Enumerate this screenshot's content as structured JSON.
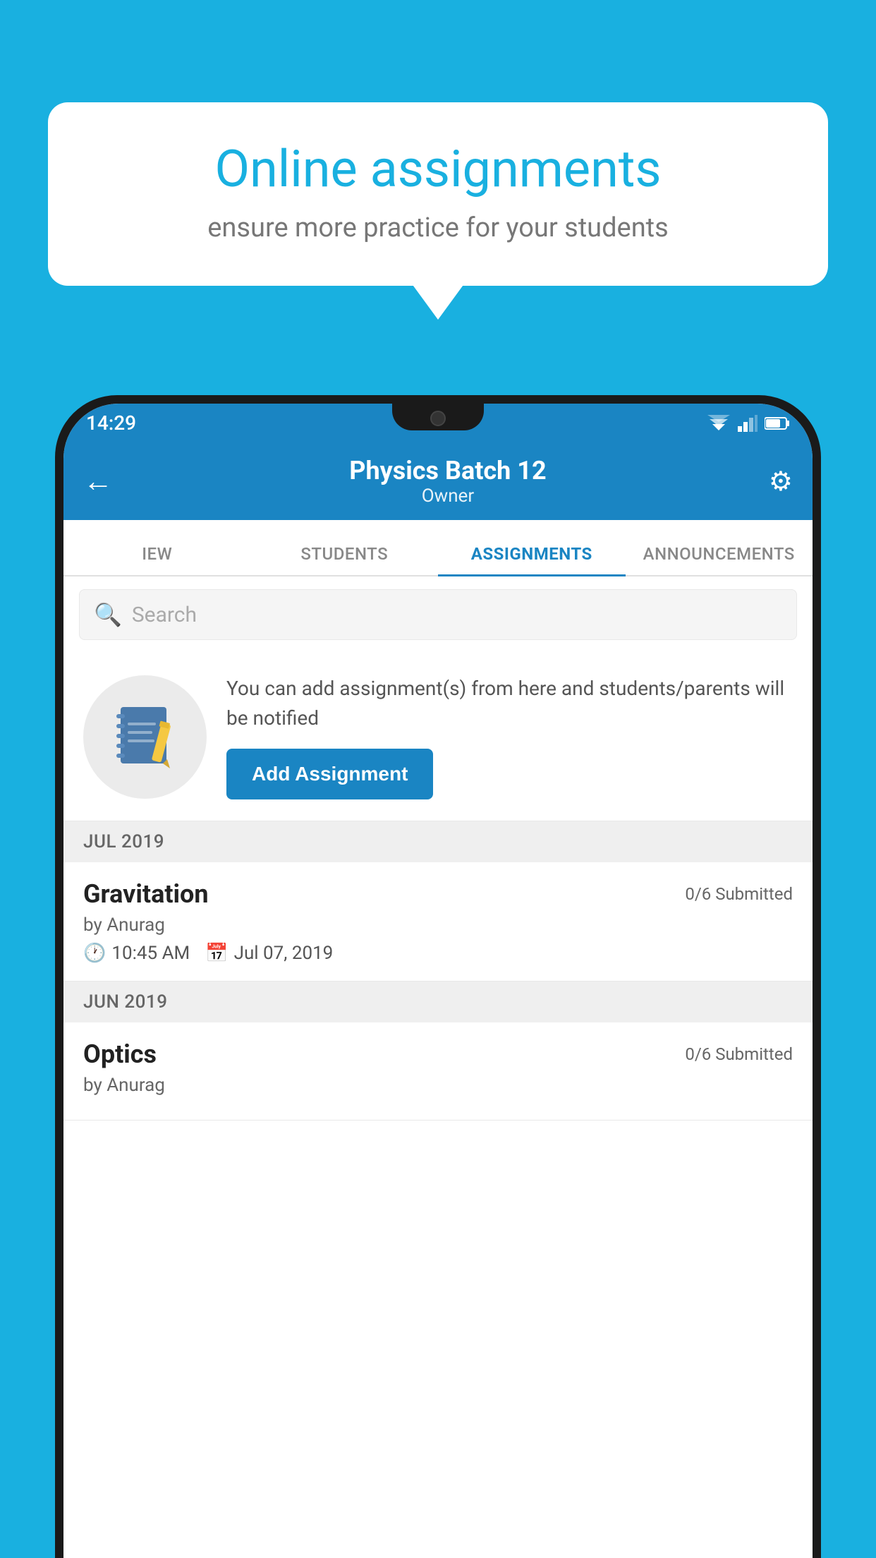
{
  "background_color": "#19b0e0",
  "speech_bubble": {
    "title": "Online assignments",
    "subtitle": "ensure more practice for your students"
  },
  "status_bar": {
    "time": "14:29"
  },
  "app_bar": {
    "title": "Physics Batch 12",
    "subtitle": "Owner",
    "back_label": "←",
    "settings_label": "⚙"
  },
  "tabs": [
    {
      "label": "IEW",
      "active": false
    },
    {
      "label": "STUDENTS",
      "active": false
    },
    {
      "label": "ASSIGNMENTS",
      "active": true
    },
    {
      "label": "ANNOUNCEMENTS",
      "active": false
    }
  ],
  "search": {
    "placeholder": "Search"
  },
  "promo": {
    "text": "You can add assignment(s) from here and students/parents will be notified",
    "button_label": "Add Assignment"
  },
  "sections": [
    {
      "header": "JUL 2019",
      "assignments": [
        {
          "title": "Gravitation",
          "submitted": "0/6 Submitted",
          "author": "by Anurag",
          "time": "10:45 AM",
          "date": "Jul 07, 2019"
        }
      ]
    },
    {
      "header": "JUN 2019",
      "assignments": [
        {
          "title": "Optics",
          "submitted": "0/6 Submitted",
          "author": "by Anurag",
          "time": "",
          "date": ""
        }
      ]
    }
  ]
}
